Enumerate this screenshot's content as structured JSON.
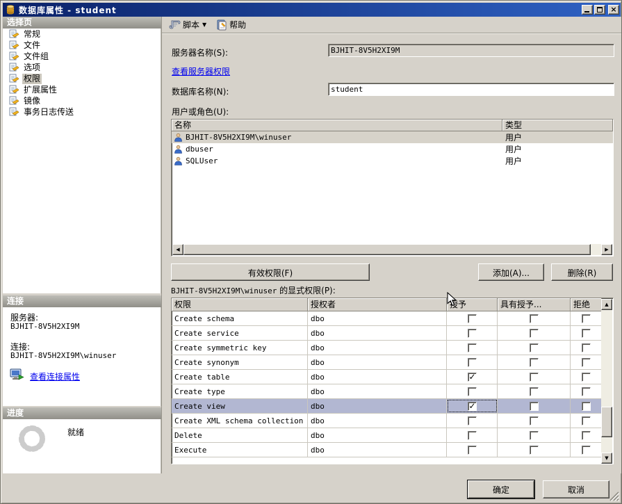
{
  "window": {
    "title": "数据库属性 - student"
  },
  "sidebar": {
    "select_page": {
      "header": "选择页",
      "items": [
        {
          "label": "常规",
          "selected": false
        },
        {
          "label": "文件",
          "selected": false
        },
        {
          "label": "文件组",
          "selected": false
        },
        {
          "label": "选项",
          "selected": false
        },
        {
          "label": "权限",
          "selected": true
        },
        {
          "label": "扩展属性",
          "selected": false
        },
        {
          "label": "镜像",
          "selected": false
        },
        {
          "label": "事务日志传送",
          "selected": false
        }
      ]
    },
    "connection": {
      "header": "连接",
      "server_label": "服务器:",
      "server_value": "BJHIT-8V5H2XI9M",
      "login_label": "连接:",
      "login_value": "BJHIT-8V5H2XI9M\\winuser",
      "view_link": "查看连接属性"
    },
    "progress": {
      "header": "进度",
      "status": "就绪"
    }
  },
  "toolbar": {
    "script": "脚本",
    "help": "帮助"
  },
  "form": {
    "server_name_label": "服务器名称(S):",
    "server_name_value": "BJHIT-8V5H2XI9M",
    "view_server_permissions_link": "查看服务器权限",
    "database_name_label": "数据库名称(N):",
    "database_name_value": "student",
    "users_label": "用户或角色(U):"
  },
  "users": {
    "columns": [
      "名称",
      "类型"
    ],
    "rows": [
      {
        "name": "BJHIT-8V5H2XI9M\\winuser",
        "type": "用户",
        "selected": true
      },
      {
        "name": "dbuser",
        "type": "用户",
        "selected": false
      },
      {
        "name": "SQLUser",
        "type": "用户",
        "selected": false
      }
    ]
  },
  "actions": {
    "effective_permissions": "有效权限(F)",
    "add": "添加(A)...",
    "remove": "删除(R)"
  },
  "explicit": {
    "user": "BJHIT-8V5H2XI9M\\winuser",
    "suffix": " 的显式权限(P):"
  },
  "permissions": {
    "columns": [
      "权限",
      "授权者",
      "授予",
      "具有授予...",
      "拒绝"
    ],
    "rows": [
      {
        "permission": "Create schema",
        "grantor": "dbo",
        "grant": false,
        "with_grant": false,
        "deny": false,
        "selected": false
      },
      {
        "permission": "Create service",
        "grantor": "dbo",
        "grant": false,
        "with_grant": false,
        "deny": false,
        "selected": false
      },
      {
        "permission": "Create symmetric key",
        "grantor": "dbo",
        "grant": false,
        "with_grant": false,
        "deny": false,
        "selected": false
      },
      {
        "permission": "Create synonym",
        "grantor": "dbo",
        "grant": false,
        "with_grant": false,
        "deny": false,
        "selected": false
      },
      {
        "permission": "Create table",
        "grantor": "dbo",
        "grant": true,
        "with_grant": false,
        "deny": false,
        "selected": false
      },
      {
        "permission": "Create type",
        "grantor": "dbo",
        "grant": false,
        "with_grant": false,
        "deny": false,
        "selected": false
      },
      {
        "permission": "Create view",
        "grantor": "dbo",
        "grant": true,
        "with_grant": false,
        "deny": false,
        "selected": true
      },
      {
        "permission": "Create XML schema collection",
        "grantor": "dbo",
        "grant": false,
        "with_grant": false,
        "deny": false,
        "selected": false
      },
      {
        "permission": "Delete",
        "grantor": "dbo",
        "grant": false,
        "with_grant": false,
        "deny": false,
        "selected": false
      },
      {
        "permission": "Execute",
        "grantor": "dbo",
        "grant": false,
        "with_grant": false,
        "deny": false,
        "selected": false
      }
    ]
  },
  "footer": {
    "ok": "确定",
    "cancel": "取消"
  },
  "colors": {
    "titlebar_left": "#0a2168",
    "titlebar_right": "#2f62c4",
    "selected_permission_row": "#b2b7d2",
    "link": "#0000ee"
  }
}
